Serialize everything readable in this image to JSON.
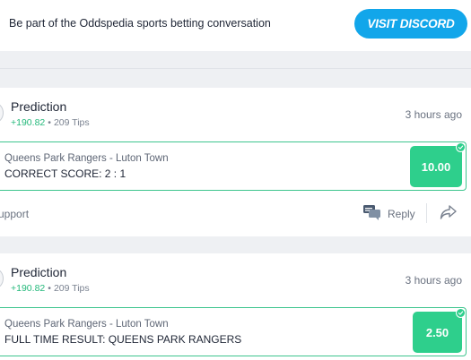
{
  "banner": {
    "text": "Be part of the Oddspedia sports betting conversation",
    "button_label": "VISIT DISCORD",
    "button_color": "#12a6ea"
  },
  "posts": [
    {
      "title": "Prediction",
      "profit": "+190.82",
      "tips": "209 Tips",
      "time": "3 hours ago",
      "match": "Queens Park Rangers - Luton Town",
      "bet": "CORRECT SCORE: 2 : 1",
      "odds": "10.00",
      "status_icon": "check-icon",
      "actions": {
        "support": "upport",
        "reply": "Reply"
      }
    },
    {
      "title": "Prediction",
      "profit": "+190.82",
      "tips": "209 Tips",
      "time": "3 hours ago",
      "match": "Queens Park Rangers - Luton Town",
      "bet": "FULL TIME RESULT: QUEENS PARK RANGERS",
      "odds": "2.50",
      "status_icon": "check-icon"
    }
  ],
  "colors": {
    "accent_green": "#2ecf8c",
    "profit_green": "#23b87a",
    "pick_border": "#3ec58e"
  }
}
